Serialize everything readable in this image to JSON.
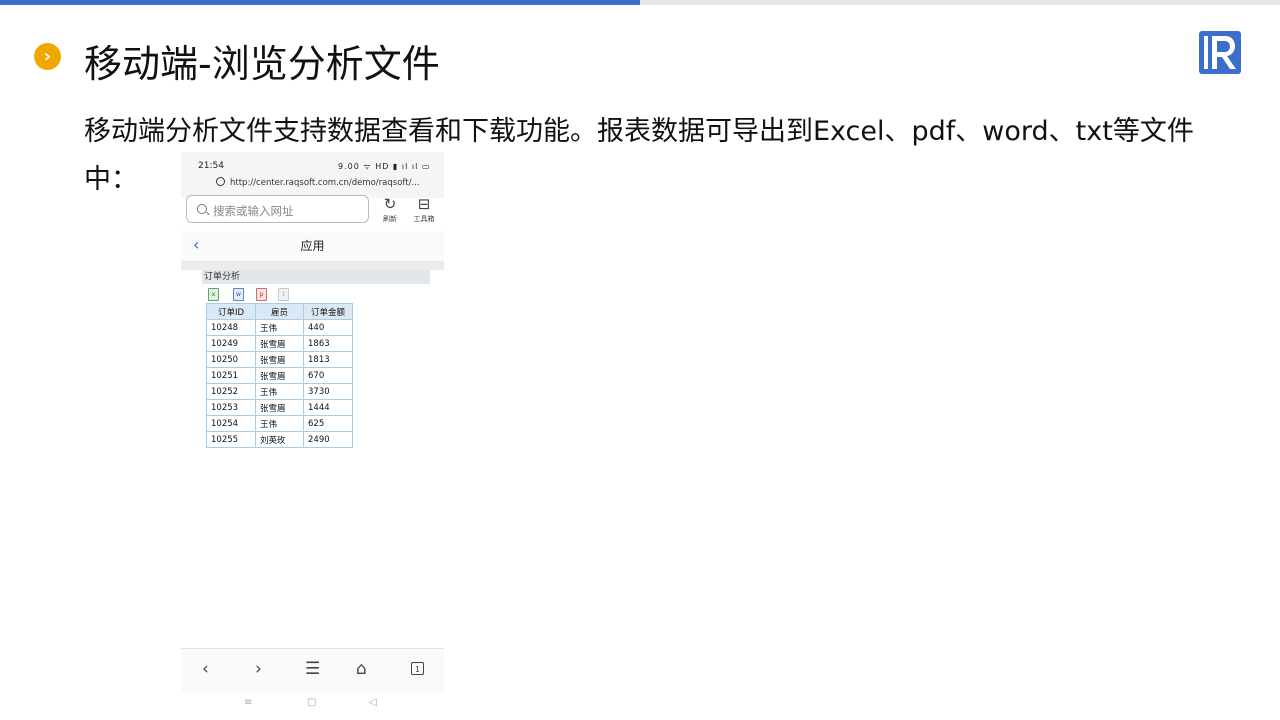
{
  "slide": {
    "title": "移动端-浏览分析文件",
    "bullet_icon": "chevron-right-icon",
    "logo": "raqsoft-r-logo",
    "body": "移动端分析文件支持数据查看和下载功能。报表数据可导出到Excel、pdf、word、txt等文件中："
  },
  "colors": {
    "accent_blue": "#3b6fcb",
    "bullet_orange": "#f0a800"
  },
  "phone": {
    "status_time": "21:54",
    "status_icons": "9.00 ᯤ HD ▮ ıl ıl ▭",
    "url": "http://center.raqsoft.com.cn/demo/raqsoft/...",
    "search_placeholder": "搜索或输入网址",
    "refresh_label": "刷新",
    "toolbox_label": "工具箱",
    "nav_title": "应用",
    "report_title": "订单分析",
    "export_icons": [
      "excel-icon",
      "word-icon",
      "pdf-icon",
      "txt-icon"
    ],
    "table": {
      "headers": [
        "订单ID",
        "雇员",
        "订单金额"
      ],
      "rows": [
        [
          "10248",
          "王伟",
          "440"
        ],
        [
          "10249",
          "张雪眉",
          "1863"
        ],
        [
          "10250",
          "张雪眉",
          "1813"
        ],
        [
          "10251",
          "张雪眉",
          "670"
        ],
        [
          "10252",
          "王伟",
          "3730"
        ],
        [
          "10253",
          "张雪眉",
          "1444"
        ],
        [
          "10254",
          "王伟",
          "625"
        ],
        [
          "10255",
          "刘英玫",
          "2490"
        ]
      ]
    },
    "tab_count": "1"
  }
}
